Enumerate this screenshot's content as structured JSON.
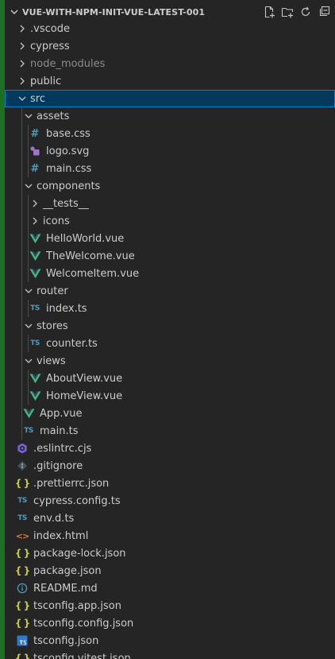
{
  "explorer": {
    "title": "VUE-WITH-NPM-INIT-VUE-LATEST-001",
    "actions": [
      "new-file-icon",
      "new-folder-icon",
      "refresh-icon",
      "collapse-all-icon"
    ]
  },
  "tree": [
    {
      "label": ".vscode",
      "depth": 0,
      "kind": "folder",
      "expanded": false
    },
    {
      "label": "cypress",
      "depth": 0,
      "kind": "folder",
      "expanded": false
    },
    {
      "label": "node_modules",
      "depth": 0,
      "kind": "folder",
      "expanded": false,
      "dim": true
    },
    {
      "label": "public",
      "depth": 0,
      "kind": "folder",
      "expanded": false
    },
    {
      "label": "src",
      "depth": 0,
      "kind": "folder",
      "expanded": true,
      "selected": true
    },
    {
      "label": "assets",
      "depth": 1,
      "kind": "folder",
      "expanded": true
    },
    {
      "label": "base.css",
      "depth": 2,
      "kind": "file",
      "icon": "css"
    },
    {
      "label": "logo.svg",
      "depth": 2,
      "kind": "file",
      "icon": "svg"
    },
    {
      "label": "main.css",
      "depth": 2,
      "kind": "file",
      "icon": "css"
    },
    {
      "label": "components",
      "depth": 1,
      "kind": "folder",
      "expanded": true
    },
    {
      "label": "__tests__",
      "depth": 2,
      "kind": "folder",
      "expanded": false
    },
    {
      "label": "icons",
      "depth": 2,
      "kind": "folder",
      "expanded": false
    },
    {
      "label": "HelloWorld.vue",
      "depth": 2,
      "kind": "file",
      "icon": "vue"
    },
    {
      "label": "TheWelcome.vue",
      "depth": 2,
      "kind": "file",
      "icon": "vue"
    },
    {
      "label": "WelcomeItem.vue",
      "depth": 2,
      "kind": "file",
      "icon": "vue"
    },
    {
      "label": "router",
      "depth": 1,
      "kind": "folder",
      "expanded": true
    },
    {
      "label": "index.ts",
      "depth": 2,
      "kind": "file",
      "icon": "ts"
    },
    {
      "label": "stores",
      "depth": 1,
      "kind": "folder",
      "expanded": true
    },
    {
      "label": "counter.ts",
      "depth": 2,
      "kind": "file",
      "icon": "ts"
    },
    {
      "label": "views",
      "depth": 1,
      "kind": "folder",
      "expanded": true
    },
    {
      "label": "AboutView.vue",
      "depth": 2,
      "kind": "file",
      "icon": "vue"
    },
    {
      "label": "HomeView.vue",
      "depth": 2,
      "kind": "file",
      "icon": "vue"
    },
    {
      "label": "App.vue",
      "depth": 1,
      "kind": "file",
      "icon": "vue"
    },
    {
      "label": "main.ts",
      "depth": 1,
      "kind": "file",
      "icon": "ts"
    },
    {
      "label": ".eslintrc.cjs",
      "depth": 0,
      "kind": "file",
      "icon": "eslint"
    },
    {
      "label": ".gitignore",
      "depth": 0,
      "kind": "file",
      "icon": "git"
    },
    {
      "label": ".prettierrc.json",
      "depth": 0,
      "kind": "file",
      "icon": "json"
    },
    {
      "label": "cypress.config.ts",
      "depth": 0,
      "kind": "file",
      "icon": "ts"
    },
    {
      "label": "env.d.ts",
      "depth": 0,
      "kind": "file",
      "icon": "ts"
    },
    {
      "label": "index.html",
      "depth": 0,
      "kind": "file",
      "icon": "html"
    },
    {
      "label": "package-lock.json",
      "depth": 0,
      "kind": "file",
      "icon": "json"
    },
    {
      "label": "package.json",
      "depth": 0,
      "kind": "file",
      "icon": "json"
    },
    {
      "label": "README.md",
      "depth": 0,
      "kind": "file",
      "icon": "info"
    },
    {
      "label": "tsconfig.app.json",
      "depth": 0,
      "kind": "file",
      "icon": "json"
    },
    {
      "label": "tsconfig.config.json",
      "depth": 0,
      "kind": "file",
      "icon": "json"
    },
    {
      "label": "tsconfig.json",
      "depth": 0,
      "kind": "file",
      "icon": "tsconfig"
    },
    {
      "label": "tsconfig.vitest.json",
      "depth": 0,
      "kind": "file",
      "icon": "json"
    }
  ],
  "colors": {
    "sidebar_bg": "#252526",
    "activity_strip": "#1d6f22",
    "selection_bg": "#04395e",
    "selection_border": "#007fd4",
    "vue_green": "#41b883",
    "ts_blue": "#519aba",
    "json_yellow": "#cbcb41",
    "html_orange": "#e37933",
    "svg_purple": "#a074c4"
  }
}
